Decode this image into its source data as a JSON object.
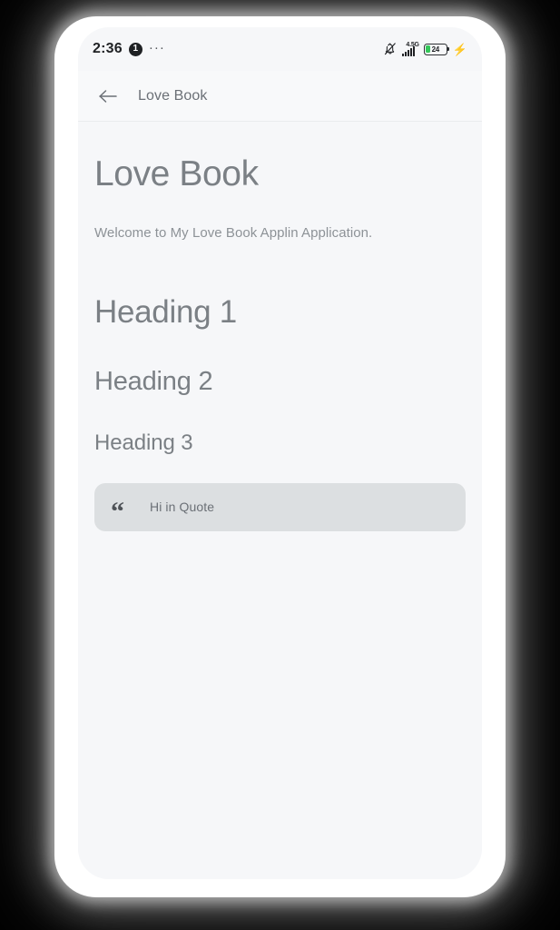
{
  "status_bar": {
    "time": "2:36",
    "notification_count": "1",
    "overflow": "···",
    "mute_icon": "bell-muted-icon",
    "network_label": "4.5G",
    "signal_bars": 5,
    "battery_percent": "24",
    "battery_level": 24,
    "charging": true,
    "battery_color": "#34c759"
  },
  "app_bar": {
    "back_icon": "arrow-left-icon",
    "title": "Love Book"
  },
  "content": {
    "doc_title": "Love Book",
    "welcome_text": "Welcome to My Love Book Applin Application.",
    "heading_1": "Heading 1",
    "heading_2": "Heading 2",
    "heading_3": "Heading 3",
    "quote": {
      "icon": "quote-mark-icon",
      "glyph": "“",
      "text": "Hi in Quote",
      "background": "#dcdfe1"
    }
  },
  "theme": {
    "page_background": "#000000",
    "frame_color": "#ffffff",
    "screen_background": "#f6f7f9",
    "text_muted": "#7b8085",
    "divider": "#e9ebee"
  }
}
